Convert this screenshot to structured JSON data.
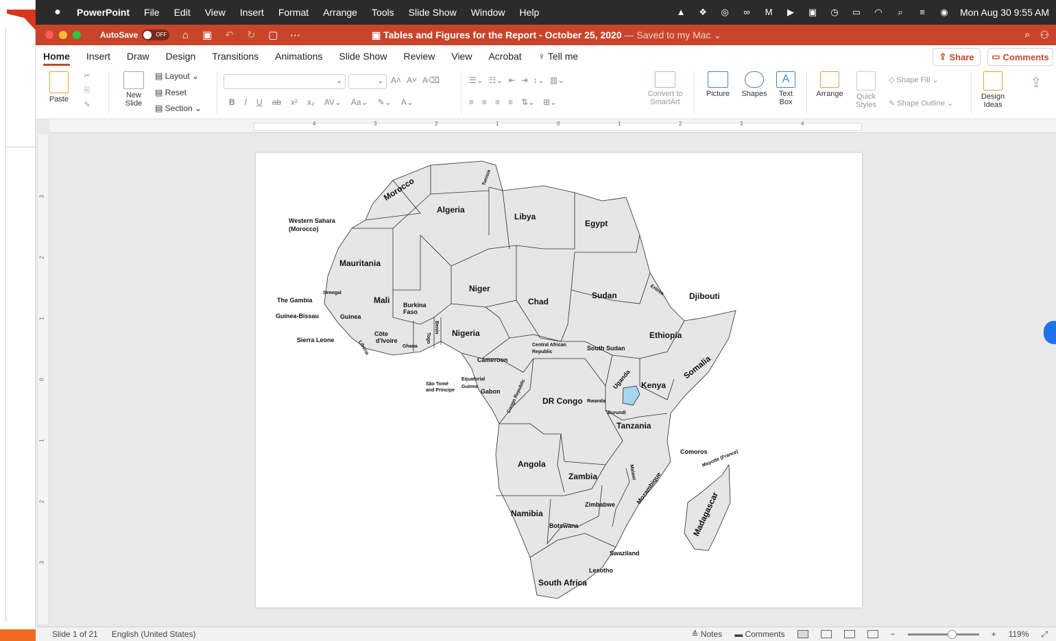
{
  "menubar": {
    "app": "PowerPoint",
    "items": [
      "File",
      "Edit",
      "View",
      "Insert",
      "Format",
      "Arrange",
      "Tools",
      "Slide Show",
      "Window",
      "Help"
    ],
    "datetime": "Mon Aug 30  9:55 AM"
  },
  "titlebar": {
    "autosave_label": "AutoSave",
    "autosave_state": "OFF",
    "doc_title": "Tables and Figures for the Report - October 25, 2020",
    "saved_status": " — Saved to my Mac ⌄"
  },
  "tabs": {
    "items": [
      "Home",
      "Insert",
      "Draw",
      "Design",
      "Transitions",
      "Animations",
      "Slide Show",
      "Review",
      "View",
      "Acrobat",
      "Tell me"
    ],
    "active": "Home",
    "share_label": "Share",
    "comments_label": "Comments"
  },
  "ribbon": {
    "paste": "Paste",
    "new_slide": "New\nSlide",
    "layout": "Layout",
    "reset": "Reset",
    "section": "Section",
    "convert_smartart": "Convert to SmartArt",
    "picture": "Picture",
    "shapes": "Shapes",
    "text_box": "Text Box",
    "arrange": "Arrange",
    "quick_styles": "Quick Styles",
    "shape_fill": "Shape Fill",
    "shape_outline": "Shape Outline",
    "design_ideas": "Design Ideas"
  },
  "ruler": {
    "h_labels": [
      "4",
      "3",
      "2",
      "1",
      "0",
      "1",
      "2",
      "3",
      "4"
    ],
    "v_labels": [
      "3",
      "2",
      "1",
      "0",
      "1",
      "2",
      "3"
    ]
  },
  "map": {
    "labels_large": [
      "Morocco",
      "Algeria",
      "Libya",
      "Egypt",
      "Mauritania",
      "Mali",
      "Niger",
      "Chad",
      "Sudan",
      "Nigeria",
      "Ethiopia",
      "Djibouti",
      "Kenya",
      "Somalia",
      "DR Congo",
      "Tanzania",
      "Angola",
      "Zambia",
      "Namibia",
      "South Africa",
      "Madagascar"
    ],
    "labels_small": [
      "Western Sahara",
      "(Morocco)",
      "The Gambia",
      "Guinea-Bissau",
      "Senegal",
      "Guinea",
      "Sierra Leone",
      "Burkina",
      "Faso",
      "Côte",
      "d'Ivoire",
      "Ghana",
      "Cameroon",
      "Central African",
      "Republic",
      "South Sudan",
      "Eritrea",
      "Uganda",
      "Rwanda",
      "Burundi",
      "Equatorial",
      "Guinea",
      "Gabon",
      "São Tomé",
      "and Príncipe",
      "Congo Republic",
      "Zimbabwe",
      "Botswana",
      "Mozambique",
      "Malawi",
      "Swaziland",
      "Lesotho",
      "Comoros",
      "Mayotte (France)",
      "Tunisia",
      "Liberia",
      "Togo",
      "Benin"
    ]
  },
  "statusbar": {
    "slide_info": "Slide 1 of 21",
    "language": "English (United States)",
    "notes": "Notes",
    "comments": "Comments",
    "zoom": "119%",
    "zoom_level": 0.62
  }
}
